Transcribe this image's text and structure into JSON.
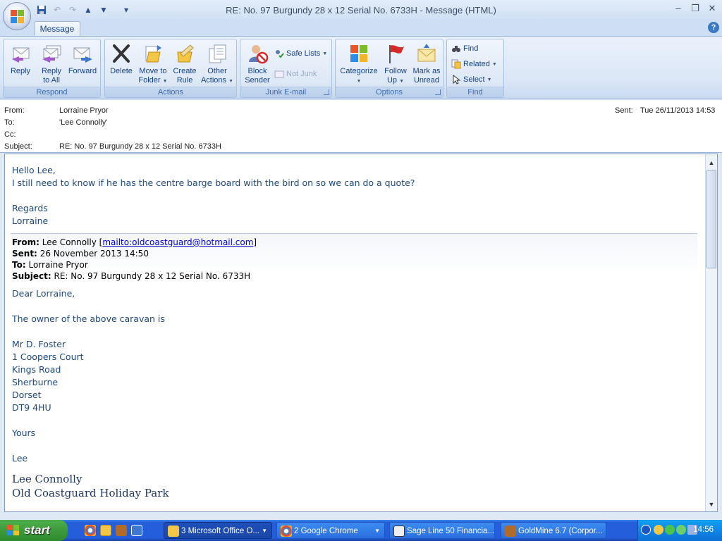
{
  "window": {
    "title": "RE: No. 97 Burgundy 28 x 12 Serial No. 6733H - Message (HTML)",
    "minimize": "–",
    "restore": "❐",
    "close": "✕"
  },
  "quick_access": {
    "save": "💾",
    "undo": "↶",
    "redo": "↷",
    "prev": "▲",
    "next": "▼",
    "customize": "▾"
  },
  "tabs": [
    {
      "label": "Message"
    }
  ],
  "help": "?",
  "ribbon": {
    "groups": [
      {
        "label": "Respond",
        "buttons": [
          "Reply",
          "Reply\nto All",
          "Forward"
        ]
      },
      {
        "label": "Actions",
        "buttons": [
          "Delete",
          "Move to\nFolder",
          "Create\nRule",
          "Other\nActions"
        ]
      },
      {
        "label": "Junk E-mail",
        "buttons": [
          "Block\nSender"
        ],
        "small": [
          "Safe Lists",
          "Not Junk"
        ]
      },
      {
        "label": "Options",
        "buttons": [
          "Categorize",
          "Follow\nUp",
          "Mark as\nUnread"
        ]
      },
      {
        "label": "Find",
        "small": [
          "Find",
          "Related",
          "Select"
        ]
      }
    ],
    "respond": {
      "reply": "Reply",
      "reply_all_1": "Reply",
      "reply_all_2": "to All",
      "forward": "Forward",
      "label": "Respond"
    },
    "actions": {
      "delete": "Delete",
      "move_1": "Move to",
      "move_2": "Folder",
      "rule_1": "Create",
      "rule_2": "Rule",
      "other_1": "Other",
      "other_2": "Actions",
      "label": "Actions"
    },
    "junk": {
      "block_1": "Block",
      "block_2": "Sender",
      "safe_lists": "Safe Lists",
      "not_junk": "Not Junk",
      "label": "Junk E-mail"
    },
    "options": {
      "categorize": "Categorize",
      "follow_1": "Follow",
      "follow_2": "Up",
      "mark_1": "Mark as",
      "mark_2": "Unread",
      "label": "Options"
    },
    "find": {
      "find": "Find",
      "related": "Related",
      "select": "Select",
      "label": "Find"
    }
  },
  "header": {
    "from_label": "From:",
    "from": "Lorraine Pryor",
    "to_label": "To:",
    "to": "'Lee Connolly'",
    "cc_label": "Cc:",
    "cc": "",
    "subject_label": "Subject:",
    "subject": "RE: No. 97 Burgundy 28 x 12 Serial No. 6733H",
    "sent_label": "Sent:",
    "sent": "Tue 26/11/2013 14:53"
  },
  "body": {
    "reply_lines": [
      "Hello Lee,",
      "I still need to know if he has the centre barge board with the bird on so we can do a quote?",
      "",
      "Regards",
      "Lorraine"
    ],
    "original": {
      "from_label": "From:",
      "from_name": "Lee Connolly",
      "from_link": "mailto:oldcoastguard@hotmail.com",
      "sent_label": "Sent:",
      "sent": "26 November 2013 14:50",
      "to_label": "To:",
      "to": "Lorraine Pryor",
      "subject_label": "Subject:",
      "subject": "RE: No. 97 Burgundy 28 x 12 Serial No. 6733H"
    },
    "original_lines": [
      "Dear Lorraine,",
      "",
      "The owner of the above caravan is",
      "",
      "Mr D. Foster",
      "1 Coopers Court",
      "Kings Road",
      "Sherburne",
      "Dorset",
      "DT9 4HU",
      "",
      "Yours",
      "",
      "Lee"
    ],
    "signature_name": "Lee Connolly",
    "signature_line2": "Old Coastguard Holiday Park"
  },
  "taskbar": {
    "start": "start",
    "items": [
      {
        "label": "3 Microsoft Office O...",
        "active": true
      },
      {
        "label": "2 Google Chrome",
        "active": false
      },
      {
        "label": "Sage Line 50 Financia...",
        "active": false
      },
      {
        "label": "GoldMine 6.7 (Corpor...",
        "active": false
      }
    ],
    "clock": "14:56"
  },
  "colors": {
    "ribbon_text": "#15428b",
    "body_text": "#1f497d",
    "taskbar_blue": "#245edb",
    "start_green": "#3c9a3c"
  }
}
